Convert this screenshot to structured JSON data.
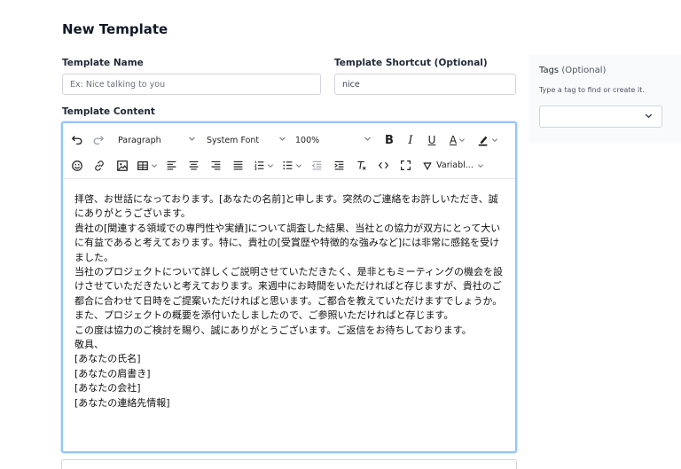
{
  "page": {
    "title": "New Template"
  },
  "template_name": {
    "label": "Template Name",
    "placeholder": "Ex: Nice talking to you",
    "value": ""
  },
  "template_shortcut": {
    "label": "Template Shortcut (Optional)",
    "value": "nice"
  },
  "template_content": {
    "label": "Template Content"
  },
  "tags": {
    "label": "Tags",
    "label_optional": "(Optional)",
    "hint": "Type a tag to find or create it."
  },
  "toolbar": {
    "block_format": "Paragraph",
    "font_family": "System Font",
    "font_size": "100%",
    "bold": "B",
    "italic": "I",
    "underline": "U",
    "text_color": "A",
    "variables": "Variabl..."
  },
  "editor": {
    "lines": [
      "拝啓、お世話になっております。[あなたの名前]と申します。突然のご連絡をお許しいただき、誠にありがとうございます。",
      "貴社の[関連する領域での専門性や実績]について調査した結果、当社との協力が双方にとって大いに有益であると考えております。特に、貴社の[受賞歴や特徴的な強みなど]には非常に感銘を受けました。",
      "当社のプロジェクトについて詳しくご説明させていただきたく、是非ともミーティングの機会を設けさせていただきたいと考えております。来週中にお時間をいただければと存じますが、貴社のご都合に合わせて日時をご提案いただければと思います。ご都合を教えていただけますでしょうか。",
      "また、プロジェクトの概要を添付いたしましたので、ご参照いただければと存じます。",
      "この度は協力のご検討を賜り、誠にありがとうございます。ご返信をお待ちしております。",
      "敬具、",
      "[あなたの氏名]",
      "[あなたの肩書き]",
      "[あなたの会社]",
      "[あなたの連絡先情報]"
    ]
  },
  "colors": {
    "focus_border": "#93c5fd",
    "input_border": "#d1d5db",
    "panel_bg": "#f9fafb"
  }
}
